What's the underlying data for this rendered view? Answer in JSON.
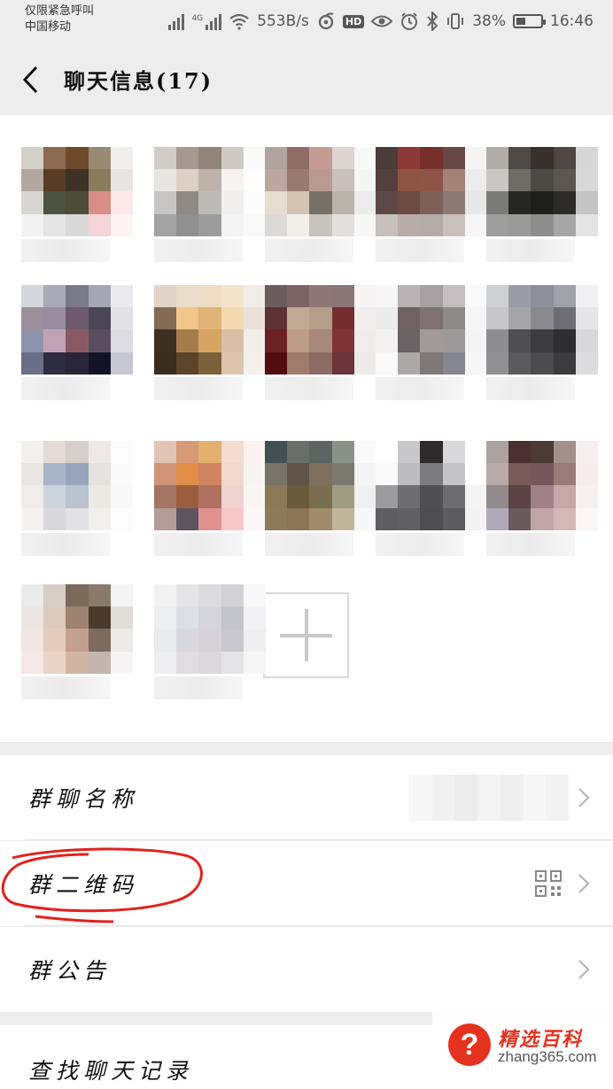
{
  "status_bar": {
    "carrier_line1": "仅限紧急呼叫",
    "carrier_line2": "中国移动",
    "network_label": "4G",
    "speed": "553B/s",
    "hd": "HD",
    "battery_percent": "38%",
    "time": "16:46"
  },
  "header": {
    "title": "聊天信息(17)"
  },
  "settings": {
    "group_name_label": "群聊名称",
    "group_qr_label": "群二维码",
    "group_notice_label": "群公告",
    "search_history_label": "查找聊天记录"
  },
  "watermark": {
    "brand": "精选百科",
    "url": "zhang365.com"
  },
  "colors": {
    "accent_red": "#e5321e",
    "annotation_red": "#e2211c"
  }
}
